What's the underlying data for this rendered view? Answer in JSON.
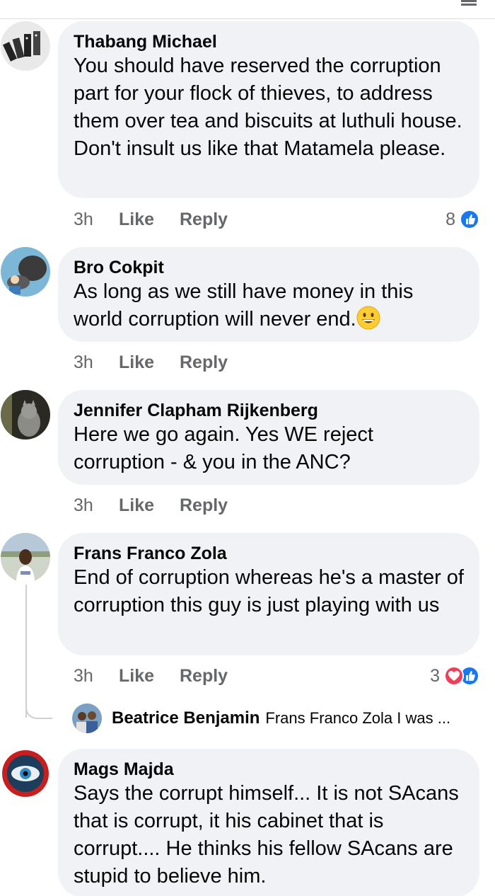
{
  "comments": [
    {
      "author": "Thabang Michael",
      "text": "You should have reserved the corruption part for your flock of thieves, to address them over tea and biscuits at luthuli house. Don't insult us like that Matamela please.",
      "time": "3h",
      "like_label": "Like",
      "reply_label": "Reply",
      "reaction_count": "8",
      "reactions": [
        "like-icon"
      ]
    },
    {
      "author": "Bro Cokpit",
      "text": "As long as we still have money in this world corruption will never end.",
      "emoji": "grinning-face-emoji",
      "time": "3h",
      "like_label": "Like",
      "reply_label": "Reply"
    },
    {
      "author": "Jennifer Clapham Rijkenberg",
      "text": "Here we go again. Yes WE reject corruption - & you in the ANC?",
      "time": "3h",
      "like_label": "Like",
      "reply_label": "Reply"
    },
    {
      "author": "Frans Franco Zola",
      "text": "End of corruption whereas he's a master of corruption this guy is just playing with us",
      "time": "3h",
      "like_label": "Like",
      "reply_label": "Reply",
      "reaction_count": "3",
      "reactions": [
        "love-icon",
        "like-icon"
      ],
      "reply_preview": {
        "author": "Beatrice Benjamin",
        "text": "Frans Franco Zola I was ..."
      }
    },
    {
      "author": "Mags Majda",
      "text": "Says the corrupt himself... It is not SAcans that is corrupt, it his cabinet that is corrupt.... He thinks his fellow SAcans are stupid to believe him."
    }
  ],
  "colors": {
    "bubble_bg": "#f0f2f5",
    "secondary_text": "#65676b",
    "like_blue": "#1877f2",
    "love_red": "#f33e58"
  }
}
